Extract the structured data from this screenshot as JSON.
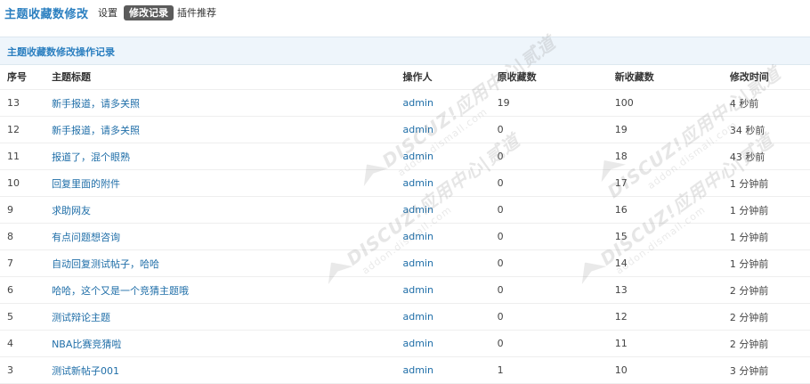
{
  "header": {
    "title": "主题收藏数修改",
    "nav": {
      "settings": "设置",
      "records": "修改记录",
      "plugins": "插件推荐"
    }
  },
  "panel": {
    "title": "主题收藏数修改操作记录"
  },
  "table": {
    "columns": [
      "序号",
      "主题标题",
      "操作人",
      "原收藏数",
      "新收藏数",
      "修改时间"
    ],
    "rows": [
      {
        "id": "13",
        "subject": "新手报道，请多关照",
        "operator": "admin",
        "old": "19",
        "new": "100",
        "time": "4 秒前"
      },
      {
        "id": "12",
        "subject": "新手报道，请多关照",
        "operator": "admin",
        "old": "0",
        "new": "19",
        "time": "34 秒前"
      },
      {
        "id": "11",
        "subject": "报道了，混个眼熟",
        "operator": "admin",
        "old": "0",
        "new": "18",
        "time": "43 秒前"
      },
      {
        "id": "10",
        "subject": "回复里面的附件",
        "operator": "admin",
        "old": "0",
        "new": "17",
        "time": "1 分钟前"
      },
      {
        "id": "9",
        "subject": "求助网友",
        "operator": "admin",
        "old": "0",
        "new": "16",
        "time": "1 分钟前"
      },
      {
        "id": "8",
        "subject": "有点问题想咨询",
        "operator": "admin",
        "old": "0",
        "new": "15",
        "time": "1 分钟前"
      },
      {
        "id": "7",
        "subject": "自动回复测试帖子，哈哈",
        "operator": "admin",
        "old": "0",
        "new": "14",
        "time": "1 分钟前"
      },
      {
        "id": "6",
        "subject": "哈哈，这个又是一个竞猜主题哦",
        "operator": "admin",
        "old": "0",
        "new": "13",
        "time": "2 分钟前"
      },
      {
        "id": "5",
        "subject": "测试辩论主题",
        "operator": "admin",
        "old": "0",
        "new": "12",
        "time": "2 分钟前"
      },
      {
        "id": "4",
        "subject": "NBA比赛竞猜啦",
        "operator": "admin",
        "old": "0",
        "new": "11",
        "time": "2 分钟前"
      },
      {
        "id": "3",
        "subject": "测试新帖子001",
        "operator": "admin",
        "old": "1",
        "new": "10",
        "time": "3 分钟前"
      }
    ]
  },
  "watermark": {
    "brand": "DISCUZ!应用中心|贰道",
    "site": "addon.dismall.com"
  }
}
